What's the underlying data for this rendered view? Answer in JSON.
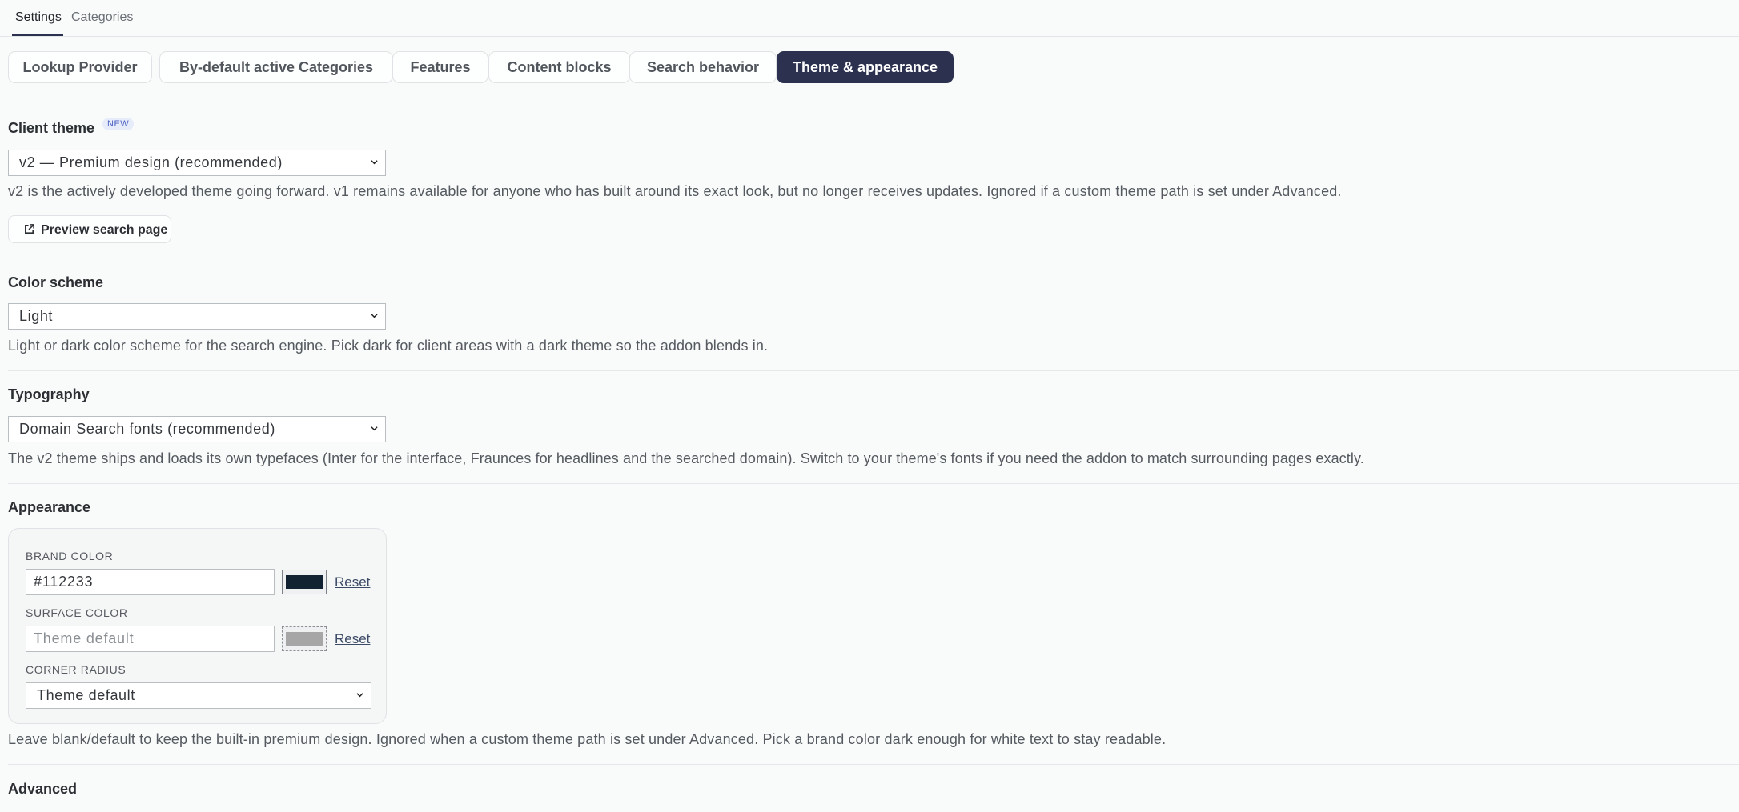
{
  "top_tabs": [
    {
      "label": "Settings",
      "active": true
    },
    {
      "label": "Categories",
      "active": false
    }
  ],
  "subnav": [
    {
      "label": "Lookup Provider",
      "active": false
    },
    {
      "label": "By-default active Categories",
      "active": false
    },
    {
      "label": "Features",
      "active": false
    },
    {
      "label": "Content blocks",
      "active": false
    },
    {
      "label": "Search behavior",
      "active": false
    },
    {
      "label": "Theme & appearance",
      "active": true
    }
  ],
  "client_theme": {
    "title": "Client theme",
    "badge": "NEW",
    "selected": "v2 — Premium design (recommended)",
    "description": "v2 is the actively developed theme going forward. v1 remains available for anyone who has built around its exact look, but no longer receives updates. Ignored if a custom theme path is set under Advanced.",
    "preview_button": "Preview search page"
  },
  "color_scheme": {
    "title": "Color scheme",
    "selected": "Light",
    "description": "Light or dark color scheme for the search engine. Pick dark for client areas with a dark theme so the addon blends in."
  },
  "typography": {
    "title": "Typography",
    "selected": "Domain Search fonts (recommended)",
    "description": "The v2 theme ships and loads its own typefaces (Inter for the interface, Fraunces for headlines and the searched domain). Switch to your theme's fonts if you need the addon to match surrounding pages exactly."
  },
  "appearance": {
    "title": "Appearance",
    "brand_color_label": "BRAND COLOR",
    "brand_color_value": "#112233",
    "brand_color_swatch": "#112233",
    "surface_color_label": "SURFACE COLOR",
    "surface_color_placeholder": "Theme default",
    "surface_color_swatch": "#a6a6a6",
    "reset_label": "Reset",
    "corner_radius_label": "CORNER RADIUS",
    "corner_radius_selected": "Theme default",
    "description": "Leave blank/default to keep the built-in premium design. Ignored when a custom theme path is set under Advanced. Pick a brand color dark enough for white text to stay readable."
  },
  "advanced": {
    "title": "Advanced"
  },
  "colors": {
    "accent": "#2c3150",
    "background": "#f9fbfa"
  }
}
